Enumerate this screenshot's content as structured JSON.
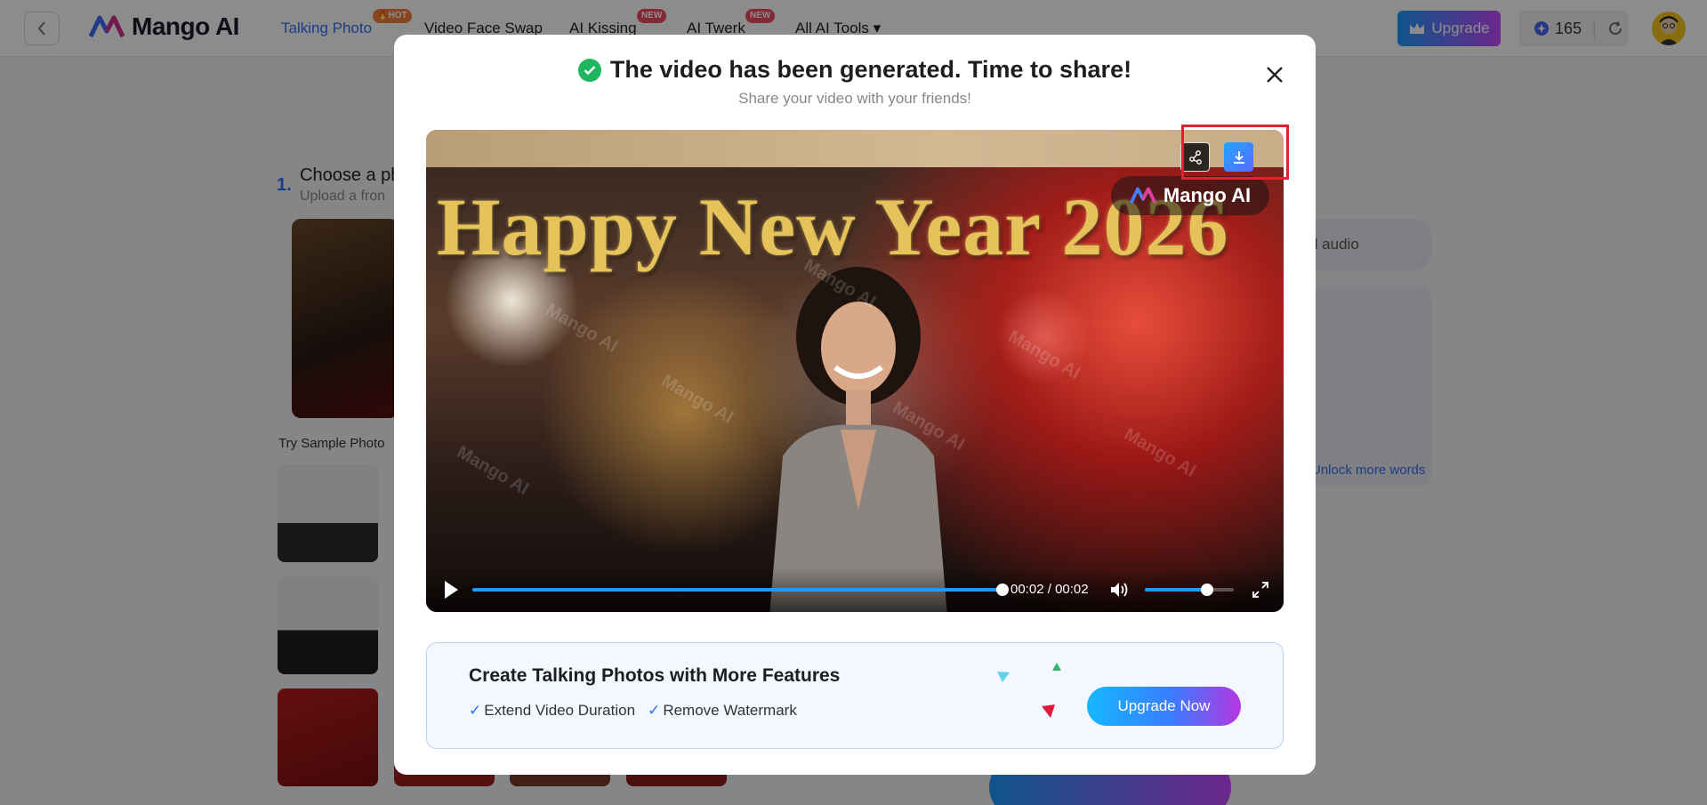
{
  "nav": {
    "logo_text": "Mango AI",
    "items": [
      {
        "label": "Talking Photo",
        "badge": "🔥HOT"
      },
      {
        "label": "Video Face Swap",
        "badge": ""
      },
      {
        "label": "AI Kissing",
        "badge": "NEW"
      },
      {
        "label": "AI Twerk",
        "badge": "NEW"
      },
      {
        "label": "All AI Tools ▾",
        "badge": ""
      }
    ],
    "upgrade_label": "Upgrade",
    "credits": "165"
  },
  "page": {
    "step_number": "1.",
    "step_title": "Choose a ph",
    "step_subtitle": "Upload a fron",
    "try_sample": "Try Sample Photo",
    "audio_tab": "d audio",
    "unlock_link": "Unlock more words"
  },
  "modal": {
    "title": "The video has been generated. Time to share!",
    "subtitle": "Share your video with your friends!",
    "video": {
      "headline": "Happy New Year 2026",
      "watermark_badge": "Mango AI",
      "watermark_repeat": "Mango AI",
      "current_time": "00:02",
      "separator": "/",
      "duration": "00:02",
      "progress_fraction": 1.0,
      "volume_fraction": 0.7
    },
    "promo": {
      "title": "Create Talking Photos with More Features",
      "features": [
        "Extend Video Duration",
        "Remove Watermark"
      ],
      "button_label": "Upgrade Now"
    }
  },
  "colors": {
    "accent": "#2f6df6",
    "success": "#20b65f",
    "highlight": "#e0232e"
  }
}
